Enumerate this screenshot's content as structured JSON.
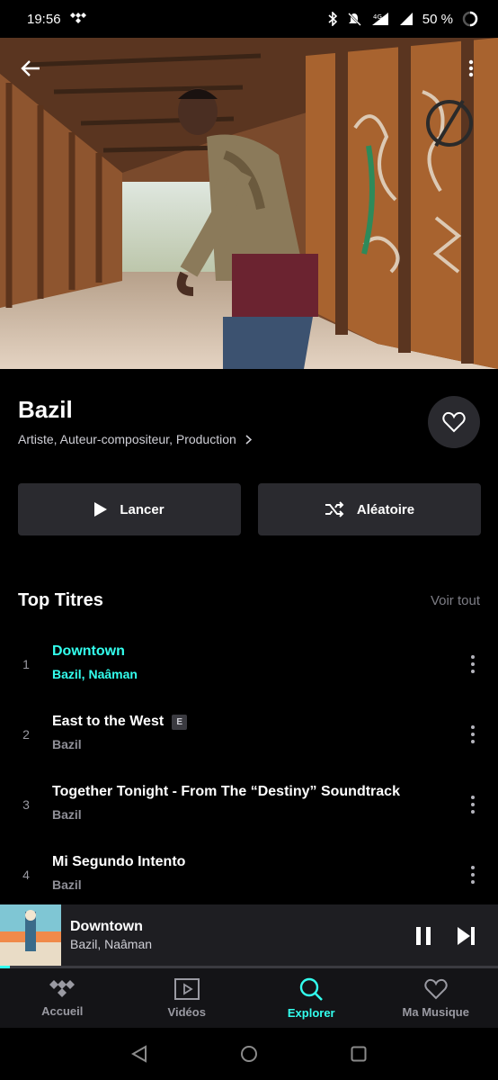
{
  "status": {
    "time": "19:56",
    "battery": "50 %",
    "network": "4G"
  },
  "artist": {
    "name": "Bazil",
    "roles": "Artiste, Auteur-compositeur, Production"
  },
  "actions": {
    "play_label": "Lancer",
    "shuffle_label": "Aléatoire"
  },
  "top_tracks": {
    "title": "Top Titres",
    "see_all": "Voir tout",
    "items": [
      {
        "num": "1",
        "title": "Downtown",
        "artist": "Bazil, Naâman",
        "explicit": "",
        "active": true
      },
      {
        "num": "2",
        "title": "East to the West",
        "artist": "Bazil",
        "explicit": "E",
        "active": false
      },
      {
        "num": "3",
        "title": "Together Tonight - From The “Destiny” Soundtrack",
        "artist": "Bazil",
        "explicit": "",
        "active": false
      },
      {
        "num": "4",
        "title": "Mi Segundo Intento",
        "artist": "Bazil",
        "explicit": "",
        "active": false
      }
    ]
  },
  "player": {
    "title": "Downtown",
    "artist": "Bazil, Naâman",
    "progress_fraction": 0.02
  },
  "nav": {
    "items": [
      {
        "label": "Accueil",
        "icon": "tidal-logo-icon"
      },
      {
        "label": "Vidéos",
        "icon": "video-icon"
      },
      {
        "label": "Explorer",
        "icon": "search-icon"
      },
      {
        "label": "Ma Musique",
        "icon": "heart-icon"
      }
    ],
    "active_index": 2
  },
  "colors": {
    "accent": "#33ffee",
    "button_bg": "#2a2a2f",
    "background": "#000000"
  }
}
